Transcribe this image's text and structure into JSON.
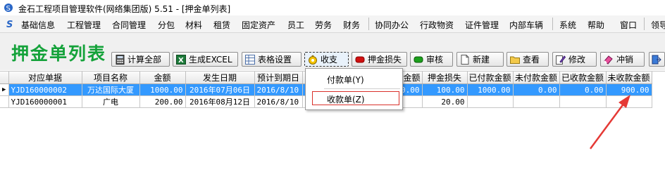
{
  "window": {
    "title": "金石工程项目管理软件(网络集团版) 5.51 - [押金单列表]"
  },
  "menu": {
    "items": [
      "基础信息",
      "工程管理",
      "合同管理",
      "分包",
      "材料",
      "租赁",
      "固定资产",
      "员工",
      "劳务",
      "财务",
      "协同办公",
      "行政物资",
      "证件管理",
      "内部车辆",
      "系统",
      "帮助",
      "窗口",
      "领导"
    ]
  },
  "page": {
    "title": "押金单列表"
  },
  "toolbar": {
    "calc_all": "计算全部",
    "excel": "生成EXCEL",
    "table_settings": "表格设置",
    "income_expense": "收支",
    "deposit_loss": "押金损失",
    "review": "审核",
    "new": "新建",
    "view": "查看",
    "edit": "修改",
    "offset": "冲销"
  },
  "dropdown": {
    "payment": "付款单(Y)",
    "receipt": "收款单(Z)"
  },
  "table": {
    "headers": [
      "对应单据",
      "项目名称",
      "金额",
      "发生日期",
      "预计到期日",
      "申请金额",
      "押金损失",
      "已付款金额",
      "未付款金额",
      "已收款金额",
      "未收款金额"
    ],
    "rows": [
      {
        "doc": "YJD160000002",
        "project": "万达国际大厦",
        "amount": "1000.00",
        "date": "2016年07月06日",
        "due": "2016/8/10",
        "apply": "0.00",
        "loss": "100.00",
        "paid": "1000.00",
        "unpaid": "0.00",
        "received": "0.00",
        "unreceived": "900.00"
      },
      {
        "doc": "YJD160000001",
        "project": "广电",
        "amount": "200.00",
        "date": "2016年08月12日",
        "due": "2016/8/10",
        "apply": "",
        "loss": "20.00",
        "paid": "",
        "unpaid": "",
        "received": "",
        "unreceived": ""
      }
    ]
  },
  "colors": {
    "accent_green": "#14a23a",
    "selection_blue": "#3399ff",
    "annotation_red": "#e53935"
  }
}
